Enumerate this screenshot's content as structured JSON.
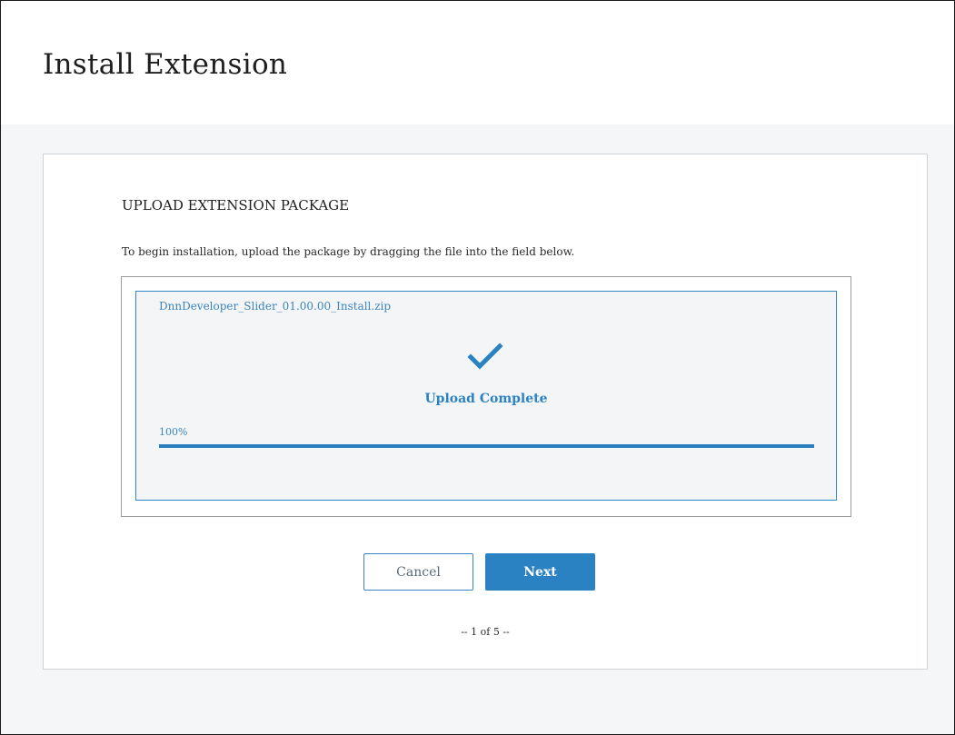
{
  "page": {
    "title": "Install Extension"
  },
  "upload_section": {
    "title": "UPLOAD EXTENSION PACKAGE",
    "instructions": "To begin installation, upload the package by dragging the file into the field below.",
    "file_name": "DnnDeveloper_Slider_01.00.00_Install.zip",
    "status_icon": "checkmark-icon",
    "status_text": "Upload Complete",
    "progress_label": "100%",
    "progress_value": 1.0
  },
  "buttons": {
    "cancel_label": "Cancel",
    "next_label": "Next"
  },
  "pagination": {
    "text": "-- 1 of 5 --"
  },
  "colors": {
    "accent": "#2b82c2",
    "accent_text": "#3b84bd",
    "panel_background": "#f4f5f7",
    "page_background": "#f5f6f7"
  }
}
